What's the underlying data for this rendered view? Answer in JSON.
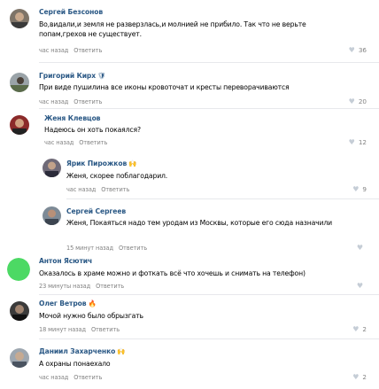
{
  "comments": [
    {
      "author": "Сергей Безсонов",
      "badge": "",
      "text": "Во,видали,и земля не разверзлась,и молнией не прибило. Так что не верьте попам,грехов не существует.",
      "time": "час назад",
      "reply": "Ответить",
      "likes": "36"
    },
    {
      "author": "Григорий Кирх",
      "badge": "🛡",
      "text": "При виде пушилина все иконы кровоточат и кресты переворачиваются",
      "time": "час назад",
      "reply": "Ответить",
      "likes": "20"
    },
    {
      "author": "Женя Клевцов",
      "badge": "",
      "text": "Надеюсь он хоть покаялся?",
      "time": "час назад",
      "reply": "Ответить",
      "likes": "12"
    },
    {
      "author": "Ярик Пирожков",
      "badge": "🙌",
      "text": "Женя, скорее поблагодарил.",
      "time": "час назад",
      "reply": "Ответить",
      "likes": "9"
    },
    {
      "author": "Сергей Сергеев",
      "badge": "",
      "text": "Женя, Покаяться надо тем уродам из Москвы, которые его сюда назначили",
      "time": "15 минут назад",
      "reply": "Ответить",
      "likes": ""
    },
    {
      "author": "Антон Ясютич",
      "badge": "",
      "text": "Оказалось в храме можно и фоткать всё что хочешь и снимать на телефон)",
      "time": "23 минуты назад",
      "reply": "Ответить",
      "likes": ""
    },
    {
      "author": "Олег Ветров",
      "badge": "🔥",
      "text": "Мочой нужно было обрызгать",
      "time": "18 минут назад",
      "reply": "Ответить",
      "likes": "2"
    },
    {
      "author": "Даниил Захарченко",
      "badge": "🙌",
      "text": "А охраны понаехало",
      "time": "час назад",
      "reply": "Ответить",
      "likes": "2"
    }
  ],
  "colors": {
    "author": "#2a5885",
    "meta": "#828282",
    "heart": "#c5cdd6",
    "divider": "#e7e8ec",
    "green_avatar": "#4cd964"
  },
  "icons": {
    "like": "heart-icon"
  }
}
